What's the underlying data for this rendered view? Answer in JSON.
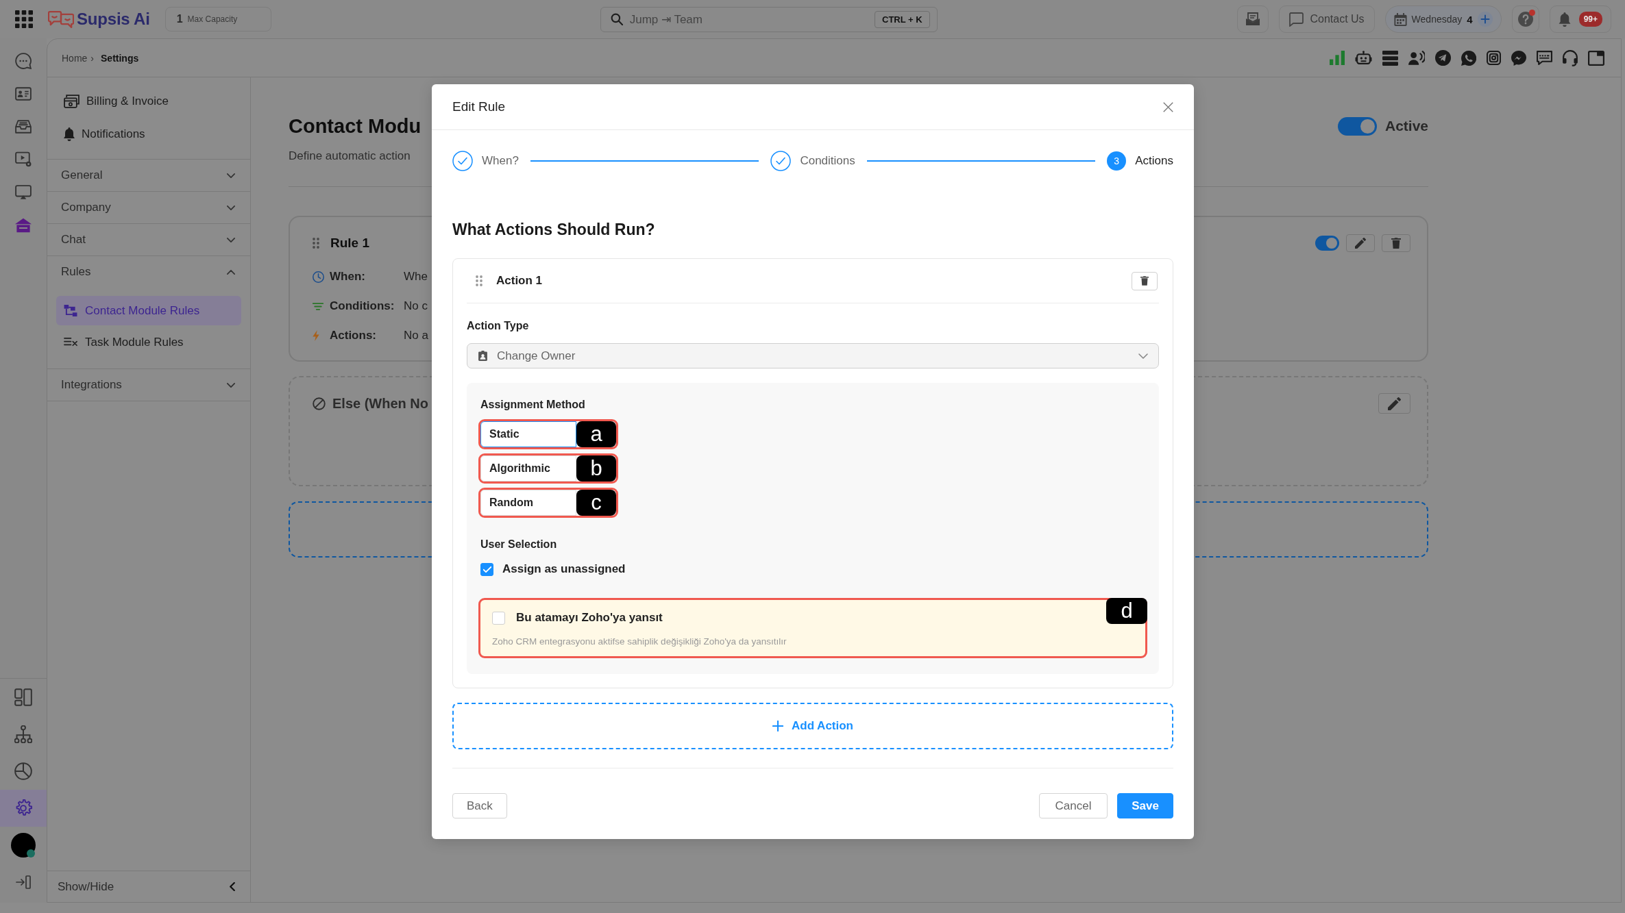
{
  "top_bar": {
    "logo": "Supsis Ai",
    "capacity": {
      "count": "1",
      "label": "Max Capacity"
    },
    "search": {
      "value": "Jump ⇥ Team",
      "shortcut": "CTRL + K"
    },
    "contact_button": "Contact Us",
    "date_chip": {
      "day": "Wednesday",
      "count": "4"
    },
    "help": {
      "alert": true
    },
    "notifications": {
      "badge": "99+"
    }
  },
  "rail": {
    "top_items": [
      {
        "selected": false
      },
      {
        "selected": false
      },
      {
        "selected": false
      },
      {
        "selected": false
      },
      {
        "selected": false
      },
      {
        "selected": false
      }
    ],
    "bottom_items": [
      {
        "selected": false
      },
      {
        "selected": false
      },
      {
        "selected": false
      },
      {
        "selected": true
      }
    ],
    "profile": {
      "online": true
    }
  },
  "breadcrumb": {
    "items": [
      {
        "label": "Home",
        "current": false
      },
      {
        "label": "Settings",
        "current": true
      }
    ],
    "separator": "›"
  },
  "settings_nav": {
    "links": [
      "Billing & Invoice",
      "Notifications"
    ],
    "sections": [
      {
        "label": "General",
        "expanded": false
      },
      {
        "label": "Company",
        "expanded": false
      },
      {
        "label": "Chat",
        "expanded": false
      },
      {
        "label": "Rules",
        "expanded": true,
        "children": [
          {
            "label": "Contact Module Rules",
            "selected": true
          },
          {
            "label": "Task Module Rules",
            "selected": false
          }
        ]
      },
      {
        "label": "Integrations",
        "expanded": false
      }
    ],
    "footer": "Show/Hide"
  },
  "page": {
    "title": "Contact Modu",
    "subtitle": "Define automatic action",
    "status": {
      "label": "Active",
      "on": true
    },
    "rules": [
      {
        "name": "Rule 1",
        "on": true,
        "fields": [
          {
            "kind": "when",
            "label": "When:",
            "value": "Whe"
          },
          {
            "kind": "conditions",
            "label": "Conditions:",
            "value": "No c"
          },
          {
            "kind": "actions",
            "label": "Actions:",
            "value": "No a"
          }
        ]
      }
    ],
    "else_rule": {
      "title": "Else (When No"
    }
  },
  "modal": {
    "title": "Edit Rule",
    "steps": [
      {
        "label": "When?",
        "completed": true
      },
      {
        "label": "Conditions",
        "completed": true
      },
      {
        "label": "Actions",
        "completed": false,
        "number": "3"
      }
    ],
    "heading": "What Actions Should Run?",
    "actions": [
      {
        "title": "Action 1",
        "type_label": "Action Type",
        "type_value": "Change Owner",
        "assignment": {
          "label": "Assignment Method",
          "options": [
            {
              "label": "Static",
              "selected": true,
              "annotation": "a"
            },
            {
              "label": "Algorithmic",
              "selected": false,
              "annotation": "b"
            },
            {
              "label": "Random",
              "selected": false,
              "annotation": "c"
            }
          ]
        },
        "user_selection": {
          "label": "User Selection",
          "checkbox": {
            "label": "Assign as unassigned",
            "checked": true
          }
        },
        "zoho": {
          "label": "Bu atamayı Zoho'ya yansıt",
          "hint": "Zoho CRM entegrasyonu aktifse sahiplik değişikliği Zoho'ya da yansıtılır",
          "checked": false,
          "annotation": "d"
        }
      }
    ],
    "add_action": "Add Action",
    "buttons": {
      "back": "Back",
      "cancel": "Cancel",
      "save": "Save"
    }
  }
}
